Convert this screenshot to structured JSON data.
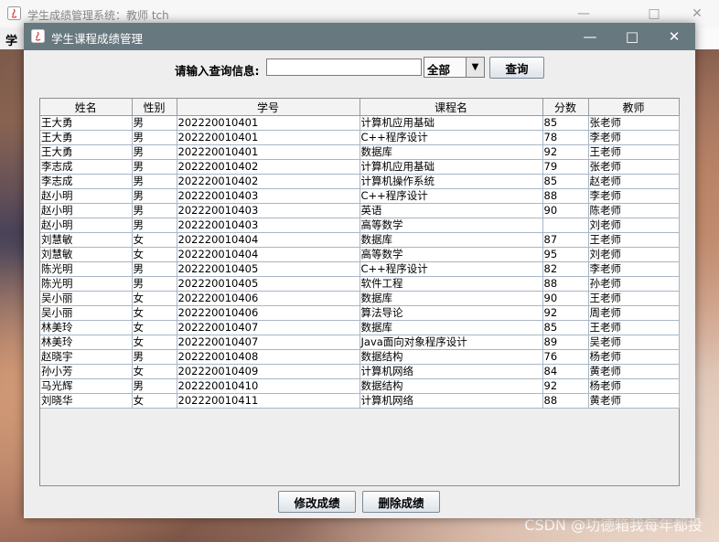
{
  "background_window": {
    "title": "学生成绩管理系统：教师 tch",
    "menu_text": "学生",
    "watermark": "CSDN @功德箱我每年都投"
  },
  "dialog": {
    "title": "学生课程成绩管理",
    "search_label": "请输入查询信息:",
    "search_value": "",
    "filter_selected": "全部",
    "query_button": "查询",
    "edit_button": "修改成绩",
    "delete_button": "删除成绩"
  },
  "table": {
    "columns": [
      "姓名",
      "性别",
      "学号",
      "课程名",
      "分数",
      "教师"
    ],
    "rows": [
      [
        "王大勇",
        "男",
        "202220010401",
        "计算机应用基础",
        "85",
        "张老师"
      ],
      [
        "王大勇",
        "男",
        "202220010401",
        "C++程序设计",
        "78",
        "李老师"
      ],
      [
        "王大勇",
        "男",
        "202220010401",
        "数据库",
        "92",
        "王老师"
      ],
      [
        "李志成",
        "男",
        "202220010402",
        "计算机应用基础",
        "79",
        "张老师"
      ],
      [
        "李志成",
        "男",
        "202220010402",
        "计算机操作系统",
        "85",
        "赵老师"
      ],
      [
        "赵小明",
        "男",
        "202220010403",
        "C++程序设计",
        "88",
        "李老师"
      ],
      [
        "赵小明",
        "男",
        "202220010403",
        "英语",
        "90",
        "陈老师"
      ],
      [
        "赵小明",
        "男",
        "202220010403",
        "高等数学",
        "",
        "刘老师"
      ],
      [
        "刘慧敏",
        "女",
        "202220010404",
        "数据库",
        "87",
        "王老师"
      ],
      [
        "刘慧敏",
        "女",
        "202220010404",
        "高等数学",
        "95",
        "刘老师"
      ],
      [
        "陈光明",
        "男",
        "202220010405",
        "C++程序设计",
        "82",
        "李老师"
      ],
      [
        "陈光明",
        "男",
        "202220010405",
        "软件工程",
        "88",
        "孙老师"
      ],
      [
        "吴小丽",
        "女",
        "202220010406",
        "数据库",
        "90",
        "王老师"
      ],
      [
        "吴小丽",
        "女",
        "202220010406",
        "算法导论",
        "92",
        "周老师"
      ],
      [
        "林美玲",
        "女",
        "202220010407",
        "数据库",
        "85",
        "王老师"
      ],
      [
        "林美玲",
        "女",
        "202220010407",
        "Java面向对象程序设计",
        "89",
        "吴老师"
      ],
      [
        "赵晓宇",
        "男",
        "202220010408",
        "数据结构",
        "76",
        "杨老师"
      ],
      [
        "孙小芳",
        "女",
        "202220010409",
        "计算机网络",
        "84",
        "黄老师"
      ],
      [
        "马光辉",
        "男",
        "202220010410",
        "数据结构",
        "92",
        "杨老师"
      ],
      [
        "刘晓华",
        "女",
        "202220010411",
        "计算机网络",
        "88",
        "黄老师"
      ]
    ]
  },
  "colors": {
    "titlebar": "#68787f",
    "grid_line": "#a8b6c4",
    "dialog_bg": "#eeeeee"
  }
}
